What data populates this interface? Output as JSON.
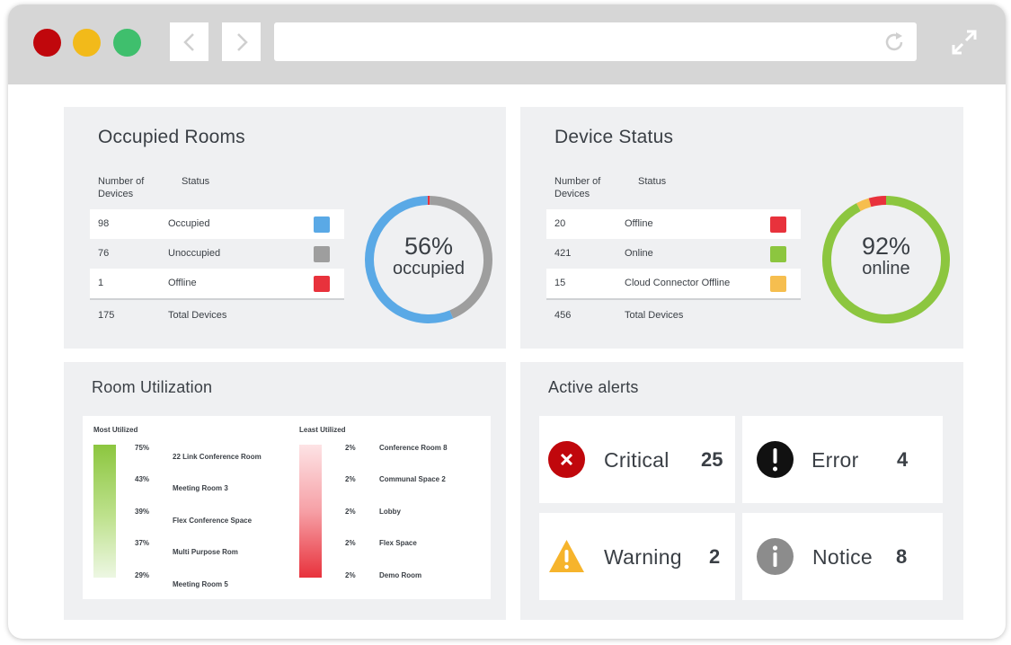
{
  "colors": {
    "occupied": "#5aa9e6",
    "unoccupied": "#9e9e9e",
    "offline": "#e8323c",
    "online": "#8cc63f",
    "cloud_offline": "#f6be4f",
    "critical": "#c0070c",
    "error": "#111111",
    "warning": "#f6b42c",
    "notice": "#8c8c8c"
  },
  "occupied_rooms": {
    "title": "Occupied Rooms",
    "col_count": "Number of Devices",
    "col_status": "Status",
    "rows": [
      {
        "count": "98",
        "status": "Occupied",
        "swatch": "#5aa9e6"
      },
      {
        "count": "76",
        "status": "Unoccupied",
        "swatch": "#9e9e9e"
      },
      {
        "count": "1",
        "status": "Offline",
        "swatch": "#e8323c"
      }
    ],
    "total_count": "175",
    "total_label": "Total Devices",
    "donut_pct": "56%",
    "donut_sub": "occupied"
  },
  "device_status": {
    "title": "Device Status",
    "col_count": "Number of Devices",
    "col_status": "Status",
    "rows": [
      {
        "count": "20",
        "status": "Offline",
        "swatch": "#e8323c"
      },
      {
        "count": "421",
        "status": "Online",
        "swatch": "#8cc63f"
      },
      {
        "count": "15",
        "status": "Cloud Connector Offline",
        "swatch": "#f6be4f"
      }
    ],
    "total_count": "456",
    "total_label": "Total Devices",
    "donut_pct": "92%",
    "donut_sub": "online"
  },
  "room_utilization": {
    "title": "Room Utilization",
    "most_label": "Most Utilized",
    "least_label": "Least Utilized",
    "most": [
      {
        "pct": "75%",
        "name": "22 Link Conference Room"
      },
      {
        "pct": "43%",
        "name": "Meeting Room 3"
      },
      {
        "pct": "39%",
        "name": "Flex Conference Space"
      },
      {
        "pct": "37%",
        "name": "Multi Purpose Rom"
      },
      {
        "pct": "29%",
        "name": "Meeting Room 5"
      }
    ],
    "least": [
      {
        "pct": "2%",
        "name": "Conference Room 8"
      },
      {
        "pct": "2%",
        "name": "Communal Space 2"
      },
      {
        "pct": "2%",
        "name": "Lobby"
      },
      {
        "pct": "2%",
        "name": "Flex Space"
      },
      {
        "pct": "2%",
        "name": "Demo Room"
      }
    ]
  },
  "active_alerts": {
    "title": "Active alerts",
    "items": [
      {
        "label": "Critical",
        "count": "25",
        "icon": "x-circle-icon"
      },
      {
        "label": "Error",
        "count": "4",
        "icon": "exclamation-circle-icon"
      },
      {
        "label": "Warning",
        "count": "2",
        "icon": "warning-triangle-icon"
      },
      {
        "label": "Notice",
        "count": "8",
        "icon": "info-circle-icon"
      }
    ]
  },
  "chart_data": [
    {
      "type": "pie",
      "title": "",
      "categories": [
        "Occupied",
        "Unoccupied",
        "Offline"
      ],
      "values": [
        98,
        76,
        1
      ]
    },
    {
      "type": "pie",
      "title": "",
      "categories": [
        "Online",
        "Offline",
        "Cloud Connector Offline"
      ],
      "values": [
        421,
        20,
        15
      ]
    }
  ]
}
